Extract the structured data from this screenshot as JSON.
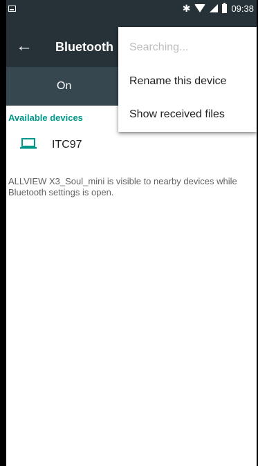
{
  "status_bar": {
    "time": "09:38",
    "icons": [
      "notification-image-icon",
      "bluetooth-icon",
      "wifi-icon",
      "signal-icon",
      "battery-icon"
    ]
  },
  "app_bar": {
    "title": "Bluetooth",
    "back_icon": "back-arrow-icon"
  },
  "toggle": {
    "label": "On"
  },
  "available_devices": {
    "header": "Available devices",
    "devices": [
      {
        "name": "ITC97",
        "icon": "laptop-icon"
      }
    ]
  },
  "visibility_notice": "ALLVIEW X3_Soul_mini is visible to nearby devices while Bluetooth settings is open.",
  "overflow_menu": {
    "items": [
      {
        "label": "Searching...",
        "enabled": false
      },
      {
        "label": "Rename this device",
        "enabled": true
      },
      {
        "label": "Show received files",
        "enabled": true
      }
    ]
  },
  "colors": {
    "app_bar": "#263238",
    "toggle_bar": "#37474f",
    "accent": "#009688",
    "menu_disabled_text": "#bdbdbd"
  }
}
